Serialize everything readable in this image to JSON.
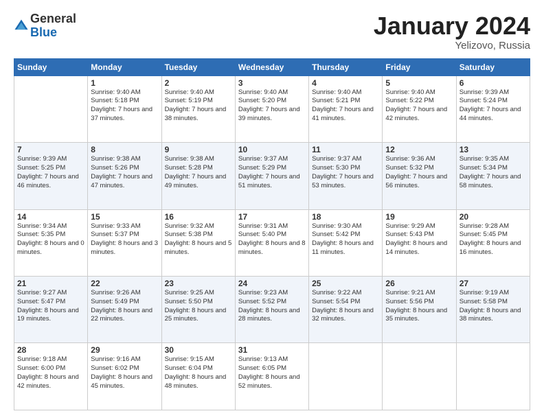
{
  "header": {
    "logo_general": "General",
    "logo_blue": "Blue",
    "month_year": "January 2024",
    "location": "Yelizovo, Russia"
  },
  "days_of_week": [
    "Sunday",
    "Monday",
    "Tuesday",
    "Wednesday",
    "Thursday",
    "Friday",
    "Saturday"
  ],
  "weeks": [
    [
      {
        "day": "",
        "sunrise": "",
        "sunset": "",
        "daylight": ""
      },
      {
        "day": "1",
        "sunrise": "Sunrise: 9:40 AM",
        "sunset": "Sunset: 5:18 PM",
        "daylight": "Daylight: 7 hours and 37 minutes."
      },
      {
        "day": "2",
        "sunrise": "Sunrise: 9:40 AM",
        "sunset": "Sunset: 5:19 PM",
        "daylight": "Daylight: 7 hours and 38 minutes."
      },
      {
        "day": "3",
        "sunrise": "Sunrise: 9:40 AM",
        "sunset": "Sunset: 5:20 PM",
        "daylight": "Daylight: 7 hours and 39 minutes."
      },
      {
        "day": "4",
        "sunrise": "Sunrise: 9:40 AM",
        "sunset": "Sunset: 5:21 PM",
        "daylight": "Daylight: 7 hours and 41 minutes."
      },
      {
        "day": "5",
        "sunrise": "Sunrise: 9:40 AM",
        "sunset": "Sunset: 5:22 PM",
        "daylight": "Daylight: 7 hours and 42 minutes."
      },
      {
        "day": "6",
        "sunrise": "Sunrise: 9:39 AM",
        "sunset": "Sunset: 5:24 PM",
        "daylight": "Daylight: 7 hours and 44 minutes."
      }
    ],
    [
      {
        "day": "7",
        "sunrise": "Sunrise: 9:39 AM",
        "sunset": "Sunset: 5:25 PM",
        "daylight": "Daylight: 7 hours and 46 minutes."
      },
      {
        "day": "8",
        "sunrise": "Sunrise: 9:38 AM",
        "sunset": "Sunset: 5:26 PM",
        "daylight": "Daylight: 7 hours and 47 minutes."
      },
      {
        "day": "9",
        "sunrise": "Sunrise: 9:38 AM",
        "sunset": "Sunset: 5:28 PM",
        "daylight": "Daylight: 7 hours and 49 minutes."
      },
      {
        "day": "10",
        "sunrise": "Sunrise: 9:37 AM",
        "sunset": "Sunset: 5:29 PM",
        "daylight": "Daylight: 7 hours and 51 minutes."
      },
      {
        "day": "11",
        "sunrise": "Sunrise: 9:37 AM",
        "sunset": "Sunset: 5:30 PM",
        "daylight": "Daylight: 7 hours and 53 minutes."
      },
      {
        "day": "12",
        "sunrise": "Sunrise: 9:36 AM",
        "sunset": "Sunset: 5:32 PM",
        "daylight": "Daylight: 7 hours and 56 minutes."
      },
      {
        "day": "13",
        "sunrise": "Sunrise: 9:35 AM",
        "sunset": "Sunset: 5:34 PM",
        "daylight": "Daylight: 7 hours and 58 minutes."
      }
    ],
    [
      {
        "day": "14",
        "sunrise": "Sunrise: 9:34 AM",
        "sunset": "Sunset: 5:35 PM",
        "daylight": "Daylight: 8 hours and 0 minutes."
      },
      {
        "day": "15",
        "sunrise": "Sunrise: 9:33 AM",
        "sunset": "Sunset: 5:37 PM",
        "daylight": "Daylight: 8 hours and 3 minutes."
      },
      {
        "day": "16",
        "sunrise": "Sunrise: 9:32 AM",
        "sunset": "Sunset: 5:38 PM",
        "daylight": "Daylight: 8 hours and 5 minutes."
      },
      {
        "day": "17",
        "sunrise": "Sunrise: 9:31 AM",
        "sunset": "Sunset: 5:40 PM",
        "daylight": "Daylight: 8 hours and 8 minutes."
      },
      {
        "day": "18",
        "sunrise": "Sunrise: 9:30 AM",
        "sunset": "Sunset: 5:42 PM",
        "daylight": "Daylight: 8 hours and 11 minutes."
      },
      {
        "day": "19",
        "sunrise": "Sunrise: 9:29 AM",
        "sunset": "Sunset: 5:43 PM",
        "daylight": "Daylight: 8 hours and 14 minutes."
      },
      {
        "day": "20",
        "sunrise": "Sunrise: 9:28 AM",
        "sunset": "Sunset: 5:45 PM",
        "daylight": "Daylight: 8 hours and 16 minutes."
      }
    ],
    [
      {
        "day": "21",
        "sunrise": "Sunrise: 9:27 AM",
        "sunset": "Sunset: 5:47 PM",
        "daylight": "Daylight: 8 hours and 19 minutes."
      },
      {
        "day": "22",
        "sunrise": "Sunrise: 9:26 AM",
        "sunset": "Sunset: 5:49 PM",
        "daylight": "Daylight: 8 hours and 22 minutes."
      },
      {
        "day": "23",
        "sunrise": "Sunrise: 9:25 AM",
        "sunset": "Sunset: 5:50 PM",
        "daylight": "Daylight: 8 hours and 25 minutes."
      },
      {
        "day": "24",
        "sunrise": "Sunrise: 9:23 AM",
        "sunset": "Sunset: 5:52 PM",
        "daylight": "Daylight: 8 hours and 28 minutes."
      },
      {
        "day": "25",
        "sunrise": "Sunrise: 9:22 AM",
        "sunset": "Sunset: 5:54 PM",
        "daylight": "Daylight: 8 hours and 32 minutes."
      },
      {
        "day": "26",
        "sunrise": "Sunrise: 9:21 AM",
        "sunset": "Sunset: 5:56 PM",
        "daylight": "Daylight: 8 hours and 35 minutes."
      },
      {
        "day": "27",
        "sunrise": "Sunrise: 9:19 AM",
        "sunset": "Sunset: 5:58 PM",
        "daylight": "Daylight: 8 hours and 38 minutes."
      }
    ],
    [
      {
        "day": "28",
        "sunrise": "Sunrise: 9:18 AM",
        "sunset": "Sunset: 6:00 PM",
        "daylight": "Daylight: 8 hours and 42 minutes."
      },
      {
        "day": "29",
        "sunrise": "Sunrise: 9:16 AM",
        "sunset": "Sunset: 6:02 PM",
        "daylight": "Daylight: 8 hours and 45 minutes."
      },
      {
        "day": "30",
        "sunrise": "Sunrise: 9:15 AM",
        "sunset": "Sunset: 6:04 PM",
        "daylight": "Daylight: 8 hours and 48 minutes."
      },
      {
        "day": "31",
        "sunrise": "Sunrise: 9:13 AM",
        "sunset": "Sunset: 6:05 PM",
        "daylight": "Daylight: 8 hours and 52 minutes."
      },
      {
        "day": "",
        "sunrise": "",
        "sunset": "",
        "daylight": ""
      },
      {
        "day": "",
        "sunrise": "",
        "sunset": "",
        "daylight": ""
      },
      {
        "day": "",
        "sunrise": "",
        "sunset": "",
        "daylight": ""
      }
    ]
  ]
}
